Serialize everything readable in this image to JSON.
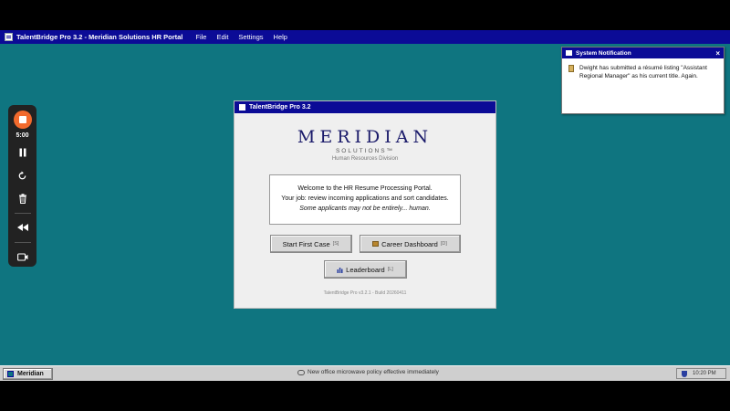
{
  "menubar": {
    "title": "TalentBridge Pro 3.2 - Meridian Solutions HR Portal",
    "menus": [
      "File",
      "Edit",
      "Settings",
      "Help"
    ]
  },
  "notification": {
    "title": "System Notification",
    "close": "×",
    "message": "Dwight has submitted a résumé listing \"Assistant Regional Manager\" as his current title. Again."
  },
  "recorder": {
    "timer": "5:00",
    "controls": [
      "stop-icon",
      "pause-icon",
      "restart-icon",
      "trash-icon",
      "rewind-icon",
      "camera-icon"
    ]
  },
  "window": {
    "title": "TalentBridge Pro 3.2",
    "brand_name": "MERIDIAN",
    "brand_sub": "SOLUTIONS™",
    "division": "Human Resources Division",
    "welcome_line1": "Welcome to the HR Resume Processing Portal.",
    "welcome_line2": "Your job: review incoming applications and sort candidates.",
    "welcome_line3": "Some applicants may not be entirely... human.",
    "start_label": "Start First Case",
    "start_key": "[S]",
    "dashboard_label": "Career Dashboard",
    "dashboard_key": "[D]",
    "leaderboard_label": "Leaderboard",
    "leaderboard_key": "[L]",
    "build": "TalentBridge Pro v3.2.1 - Build 20260411"
  },
  "taskbar": {
    "start_label": "Meridian",
    "ticker": "New office microwave policy effective immediately",
    "clock": "10:20 PM"
  }
}
